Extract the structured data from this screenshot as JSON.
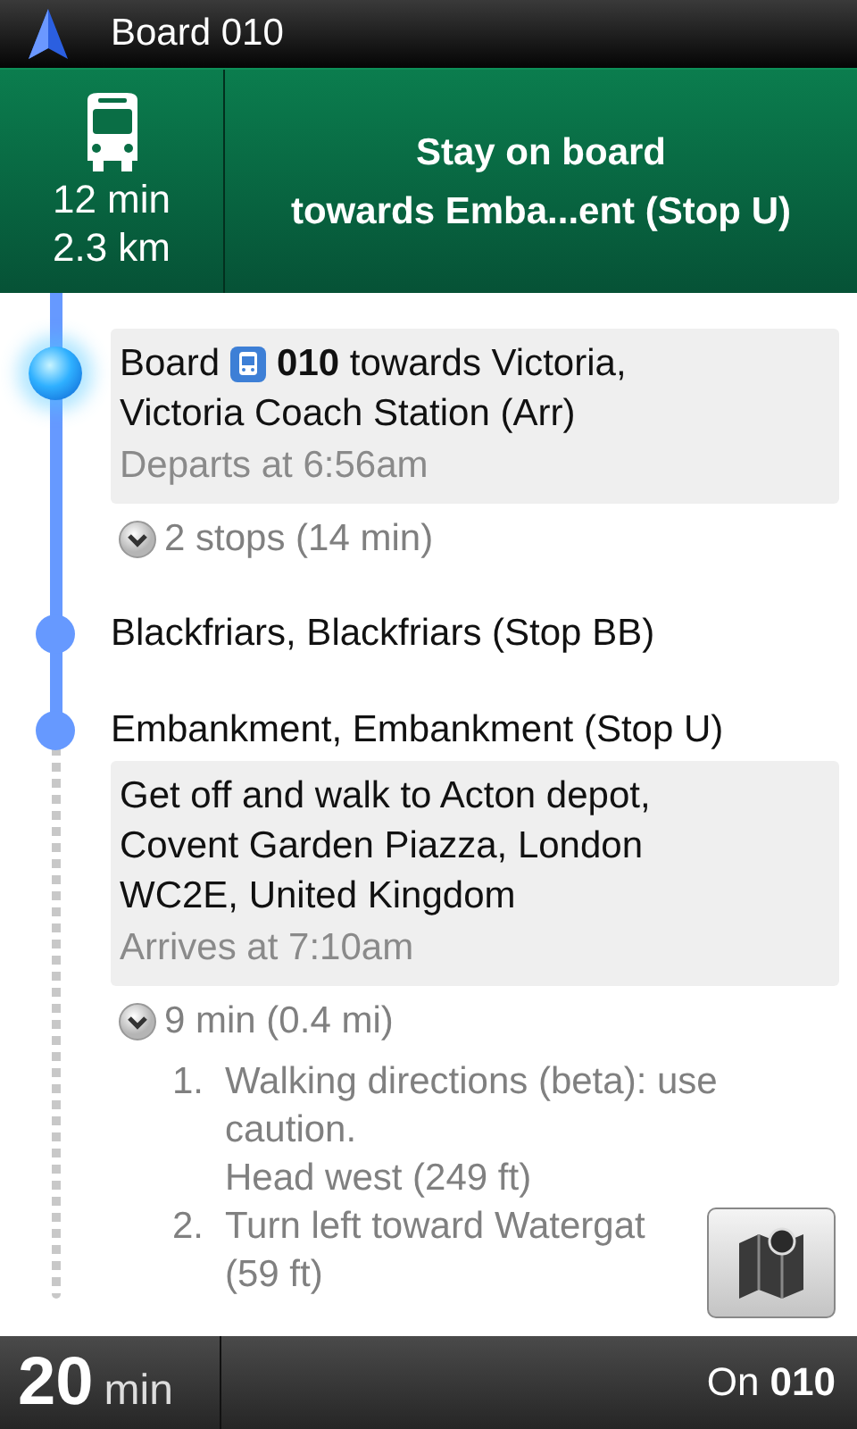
{
  "title_bar": {
    "title": "Board 010"
  },
  "maneuver": {
    "duration": "12 min",
    "distance": "2.3 km",
    "instruction": [
      "Stay on board",
      "towards Emba...ent (Stop U)"
    ]
  },
  "entries": [
    {
      "kind": "board",
      "current": true,
      "walking": false,
      "lead": "Board",
      "line_rest": "**010** towards Victoria,",
      "line_2": "Victoria Coach Station (Arr)",
      "time": "Departs at 6:56am",
      "summary": "2 stops (14 min)"
    },
    {
      "kind": "stop",
      "current": false,
      "walking": false,
      "name": "Blackfriars, Blackfriars (Stop BB)"
    },
    {
      "kind": "alight",
      "current": false,
      "walking": true,
      "name": "Embankment, Embankment (Stop U)",
      "instruction": "Get off and walk to Acton depot, Covent Garden Piazza, London WC2E, United Kingdom",
      "time": "Arrives at 7:10am",
      "summary": "9 min (0.4 mi)",
      "steps": [
        {
          "number": "1.",
          "lines": [
            "Walking directions (beta): use caution.",
            "Head west (249 ft)"
          ]
        },
        {
          "number": "2.",
          "lines": [
            "Turn left toward Watergat",
            "(59 ft)"
          ]
        }
      ]
    }
  ],
  "bottom_bar": {
    "remaining": "20",
    "unit": "min",
    "route_prefix": "On",
    "route": "010"
  }
}
